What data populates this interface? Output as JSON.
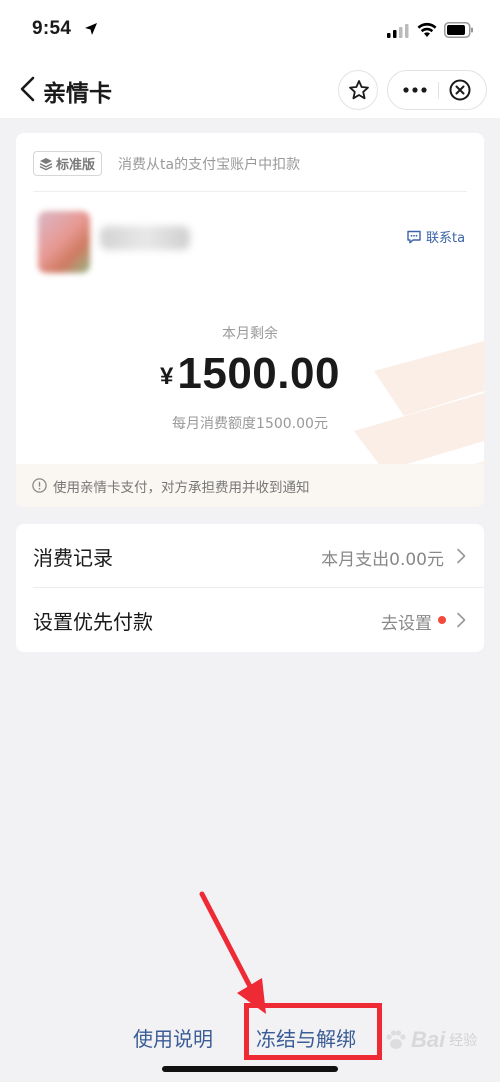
{
  "status_bar": {
    "time": "9:54"
  },
  "nav": {
    "title": "亲情卡"
  },
  "card": {
    "badge": "标准版",
    "subtitle": "消费从ta的支付宝账户中扣款",
    "contact": "联系ta",
    "remaining_label": "本月剩余",
    "currency": "¥",
    "amount": "1500.00",
    "quota": "每月消费额度1500.00元",
    "notice": "使用亲情卡支付，对方承担费用并收到通知"
  },
  "list": [
    {
      "label": "消费记录",
      "value": "本月支出0.00元"
    },
    {
      "label": "设置优先付款",
      "value": "去设置"
    }
  ],
  "bottom": {
    "manual": "使用说明",
    "freeze": "冻结与解绑"
  },
  "watermark": {
    "text": "Bai",
    "sub": "经验"
  },
  "colors": {
    "link": "#3b5d96",
    "highlight": "#ee2a34",
    "dot": "#f24b3a",
    "contact": "#3b63a8"
  }
}
